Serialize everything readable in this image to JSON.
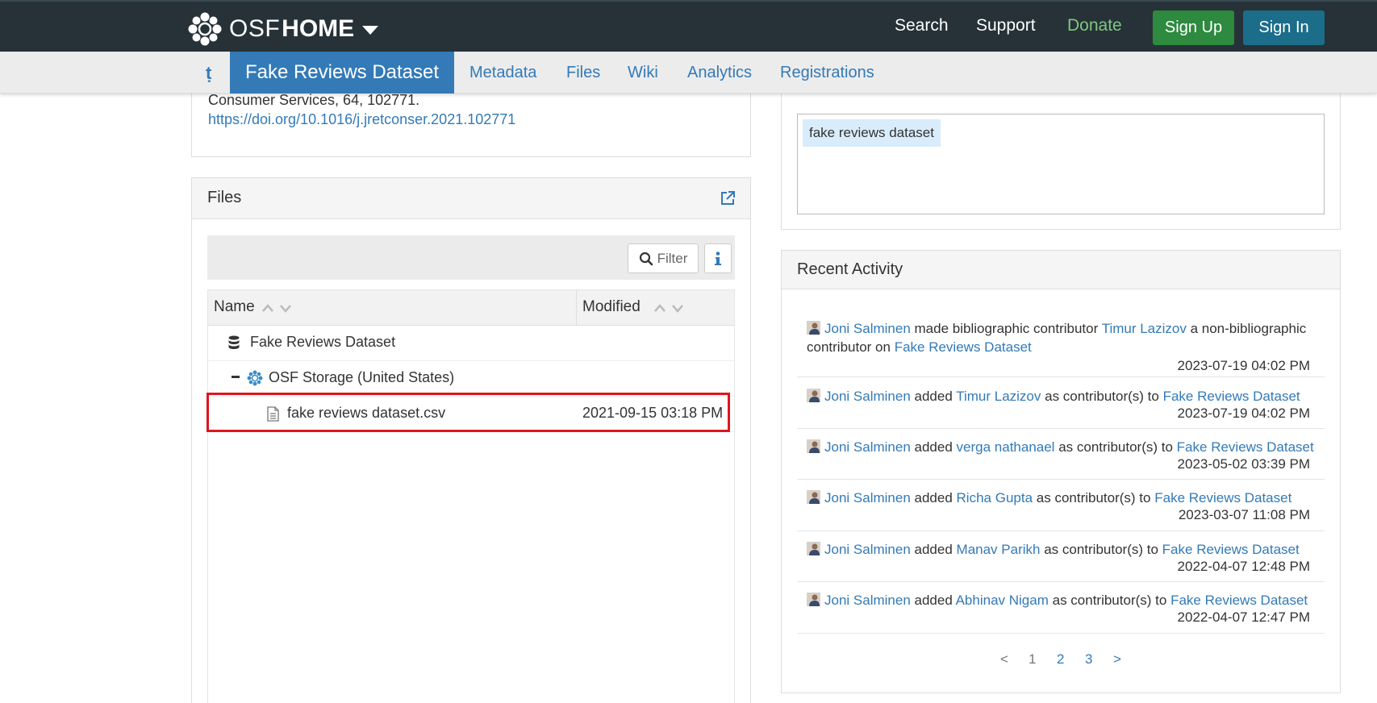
{
  "navbar": {
    "brand_osf": "OSF",
    "brand_home": "HOME",
    "search": "Search",
    "support": "Support",
    "donate": "Donate",
    "sign_up": "Sign Up",
    "sign_in": "Sign In",
    "colors": {
      "bar": "#263238",
      "donate": "#7fc77f",
      "sign_up": "#2d8a3e",
      "sign_in": "#1b6d8a"
    }
  },
  "subnav": {
    "project_title": "Fake Reviews Dataset",
    "items": [
      "Metadata",
      "Files",
      "Wiki",
      "Analytics",
      "Registrations"
    ]
  },
  "citation": {
    "text": "Consumer Services, 64, 102771.",
    "doi": "https://doi.org/10.1016/j.jretconser.2021.102771"
  },
  "files": {
    "title": "Files",
    "filter_label": "Filter",
    "columns": {
      "name": "Name",
      "modified": "Modified"
    },
    "rows": [
      {
        "name": "Fake Reviews Dataset",
        "modified": ""
      },
      {
        "name": "OSF Storage (United States)",
        "modified": ""
      },
      {
        "name": "fake reviews dataset.csv",
        "modified": "2021-09-15 03:18 PM"
      }
    ]
  },
  "tags": {
    "items": [
      "fake reviews dataset"
    ]
  },
  "activity": {
    "title": "Recent Activity",
    "items": [
      {
        "user": "Joni Salminen",
        "action": "made bibliographic contributor",
        "target": "Timur Lazizov",
        "suffix": "a non-bibliographic",
        "line2_prefix": "contributor on",
        "project": "Fake Reviews Dataset",
        "date": "2023-07-19 04:02 PM"
      },
      {
        "user": "Joni Salminen",
        "action": "added",
        "target": "Timur Lazizov",
        "suffix": "as contributor(s) to",
        "project": "Fake Reviews Dataset",
        "date": "2023-07-19 04:02 PM"
      },
      {
        "user": "Joni Salminen",
        "action": "added",
        "target": "verga nathanael",
        "suffix": "as contributor(s) to",
        "project": "Fake Reviews Dataset",
        "date": "2023-05-02 03:39 PM"
      },
      {
        "user": "Joni Salminen",
        "action": "added",
        "target": "Richa Gupta",
        "suffix": "as contributor(s) to",
        "project": "Fake Reviews Dataset",
        "date": "2023-03-07 11:08 PM"
      },
      {
        "user": "Joni Salminen",
        "action": "added",
        "target": "Manav Parikh",
        "suffix": "as contributor(s) to",
        "project": "Fake Reviews Dataset",
        "date": "2022-04-07 12:48 PM"
      },
      {
        "user": "Joni Salminen",
        "action": "added",
        "target": "Abhinav Nigam",
        "suffix": "as contributor(s) to",
        "project": "Fake Reviews Dataset",
        "date": "2022-04-07 12:47 PM"
      }
    ],
    "pager": {
      "prev": "<",
      "pages": [
        "1",
        "2",
        "3"
      ],
      "next": ">"
    }
  }
}
